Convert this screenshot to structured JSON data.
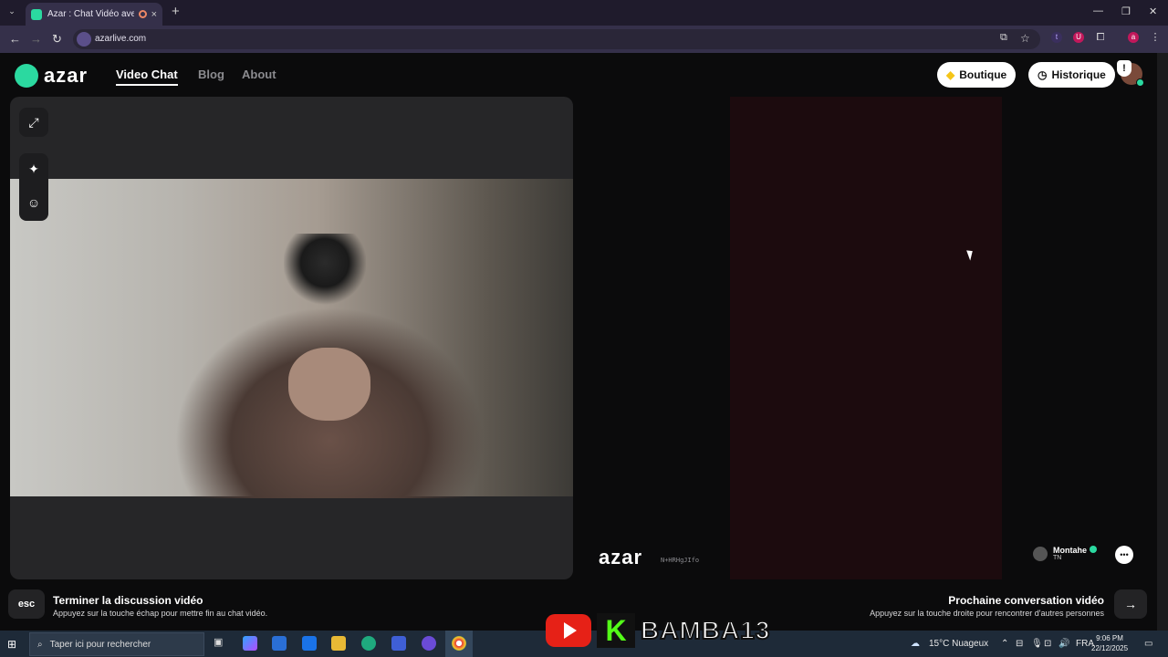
{
  "browser": {
    "tab_title": "Azar : Chat Vidéo avec de n",
    "url": "azarlive.com",
    "tab_close": "×",
    "new_tab": "+"
  },
  "header": {
    "logo_text": "azar",
    "nav": [
      "Video Chat",
      "Blog",
      "About"
    ],
    "boutique_label": "Boutique",
    "historique_label": "Historique"
  },
  "remote": {
    "watermark": "azar",
    "watermark_id": "N+HRHgJIfo",
    "peer_name": "Montahe",
    "peer_country": "TN"
  },
  "footer": {
    "esc_key": "esc",
    "end_title": "Terminer la discussion vidéo",
    "end_subtitle": "Appuyez sur la touche échap pour mettre fin au chat vidéo.",
    "next_title": "Prochaine conversation vidéo",
    "next_subtitle": "Appuyez sur la touche droite pour rencontrer d'autres personnes",
    "arrow_key": "→"
  },
  "taskbar": {
    "search_placeholder": "Taper ici pour rechercher",
    "weather": "15°C  Nuageux",
    "language": "FRA",
    "time": "9:06 PM",
    "date": "22/12/2025"
  },
  "overlay": {
    "kick_letter": "K",
    "channel_name": "BAMBA13"
  },
  "colors": {
    "accent": "#2bd9a0",
    "remote_bg": "#1c0b0e",
    "kick_green": "#53fc18",
    "youtube_red": "#e62117"
  },
  "icons": [
    "expand-icon",
    "sparkle-icon",
    "face-filter-icon",
    "shield-alert-icon",
    "chat-icon",
    "diamond-icon",
    "clock-icon"
  ]
}
